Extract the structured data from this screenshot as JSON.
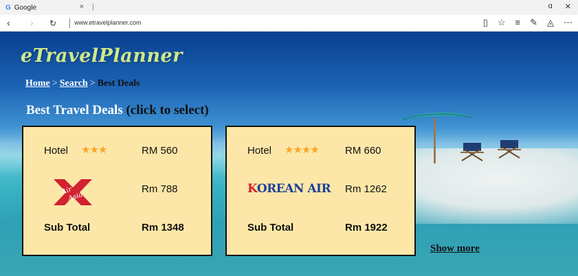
{
  "browser": {
    "tab_title": "Google",
    "tab_favicon": "G",
    "tab_close": "×",
    "new_tab": "|",
    "url": "www.etravelplanner.com",
    "window_controls": {
      "restore": "▫",
      "close": "✕",
      "maximize": "ɑ"
    }
  },
  "site": {
    "logo": "eTravelPlanner",
    "breadcrumb": {
      "home": "Home",
      "search": "Search",
      "current": "Best Deals",
      "separator": ">"
    },
    "heading": {
      "main": "Best Travel Deals",
      "sub": "(click to select)"
    }
  },
  "deals": [
    {
      "hotel_label": "Hotel",
      "hotel_stars": 3,
      "hotel_stars_text": "★★★",
      "hotel_price": "RM 560",
      "airline": "AirAsia",
      "airline_logo_text": "Air Asia",
      "flight_price": "Rm 788",
      "subtotal_label": "Sub Total",
      "subtotal": "Rm 1348"
    },
    {
      "hotel_label": "Hotel",
      "hotel_stars": 4,
      "hotel_stars_text": "★★★★",
      "hotel_price": "RM 660",
      "airline": "Korean Air",
      "airline_logo_k": "K",
      "airline_logo_rest": "OREAN AIR",
      "flight_price": "Rm 1262",
      "subtotal_label": "Sub Total",
      "subtotal": "Rm 1922"
    }
  ],
  "show_more": "Show more",
  "colors": {
    "card_bg": "#fde7a8",
    "star": "#f5a623",
    "logo": "#cfe98a",
    "airasia_red": "#d2212f",
    "korean_blue": "#1b3f9a"
  }
}
